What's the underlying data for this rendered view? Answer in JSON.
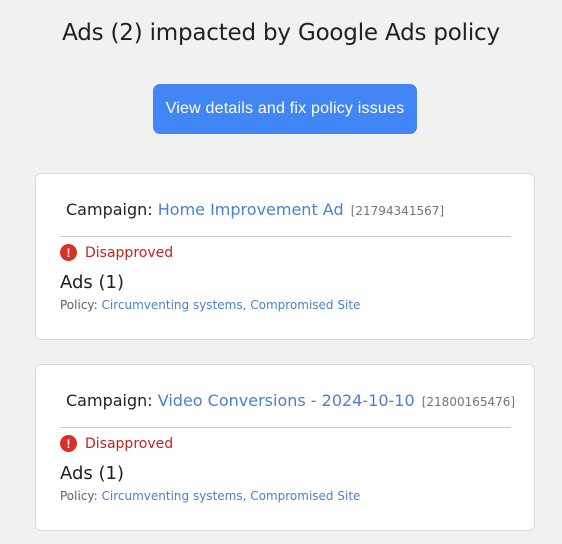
{
  "header": {
    "title": "Ads (2) impacted by Google Ads policy",
    "cta_label": "View details and fix policy issues"
  },
  "colors": {
    "accent": "#4285f4",
    "link": "#4a7fd6",
    "error": "#d93025"
  },
  "cards": [
    {
      "campaign_label": "Campaign:",
      "campaign_name": "Home Improvement Ad",
      "campaign_id": "[21794341567]",
      "status_icon": "error-icon",
      "status": "Disapproved",
      "ads_count": "Ads (1)",
      "policy_label": "Policy:",
      "policy_links": [
        "Circumventing systems",
        "Compromised Site"
      ]
    },
    {
      "campaign_label": "Campaign:",
      "campaign_name": "Video Conversions - 2024-10-10",
      "campaign_id": "[21800165476]",
      "status_icon": "error-icon",
      "status": "Disapproved",
      "ads_count": "Ads (1)",
      "policy_label": "Policy:",
      "policy_links": [
        "Circumventing systems",
        "Compromised Site"
      ]
    }
  ],
  "separator": ", "
}
